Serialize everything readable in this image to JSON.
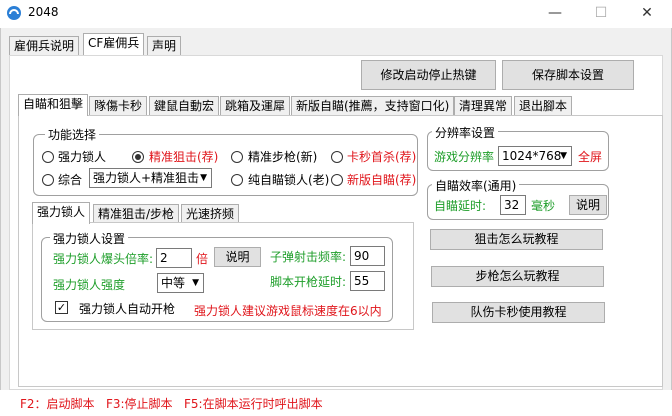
{
  "window": {
    "title": "2048",
    "minimize": "—",
    "maximize": "☐",
    "close": "✕"
  },
  "top_tabs": [
    "雇佣兵说明",
    "CF雇佣兵",
    "声明"
  ],
  "toolbar": {
    "hotkey_button": "修改启动停止热键",
    "save_button": "保存脚本设置"
  },
  "feature_tabs": [
    "自瞄和狙擊",
    "隊傷卡秒",
    "鍵鼠自動宏",
    "跳箱及運犀",
    "新版自瞄(推薦，支持窗口化)",
    "清理異常",
    "退出腳本"
  ],
  "function_group": {
    "title": "功能选择",
    "radios": [
      {
        "label": "强力锁人",
        "checked": false,
        "red": false
      },
      {
        "label": "精准狙击(荐)",
        "checked": true,
        "red": true
      },
      {
        "label": "精准步枪(新)",
        "checked": false,
        "red": false
      },
      {
        "label": "卡秒首杀(荐)",
        "checked": false,
        "red": true
      },
      {
        "label": "综合",
        "checked": false,
        "red": false
      },
      {
        "label": "纯自瞄锁人(老)",
        "checked": false,
        "red": false
      },
      {
        "label": "新版自瞄(荐)",
        "checked": false,
        "red": true
      }
    ],
    "combo_select": "强力锁人+精准狙击"
  },
  "resolution_group": {
    "title": "分辨率设置",
    "label": "游戏分辨率",
    "value": "1024*768",
    "fullscreen": "全屏"
  },
  "efficiency_group": {
    "title": "自瞄效率(通用)",
    "label": "自瞄延时:",
    "value": "32",
    "unit": "毫秒",
    "help": "说明"
  },
  "sub_tabs": [
    "强力锁人",
    "精准狙击/步枪",
    "光速挤频"
  ],
  "lock_group": {
    "title": "强力锁人设置",
    "headshot_label": "强力锁人爆头倍率:",
    "headshot_value": "2",
    "headshot_unit": "倍",
    "help": "说明",
    "fire_rate_label": "子弹射击频率:",
    "fire_rate_value": "90",
    "strength_label": "强力锁人强度",
    "strength_value": "中等",
    "delay_label": "脚本开枪延时:",
    "delay_value": "55",
    "auto_fire_label": "强力锁人自动开枪",
    "auto_fire_checked": true,
    "hint": "强力锁人建议游戏鼠标速度在6以内"
  },
  "tutorials": [
    "狙击怎么玩教程",
    "步枪怎么玩教程",
    "队伤卡秒使用教程"
  ],
  "statusbar": "F2：启动脚本   F3:停止脚本   F5:在脚本运行时呼出脚本"
}
